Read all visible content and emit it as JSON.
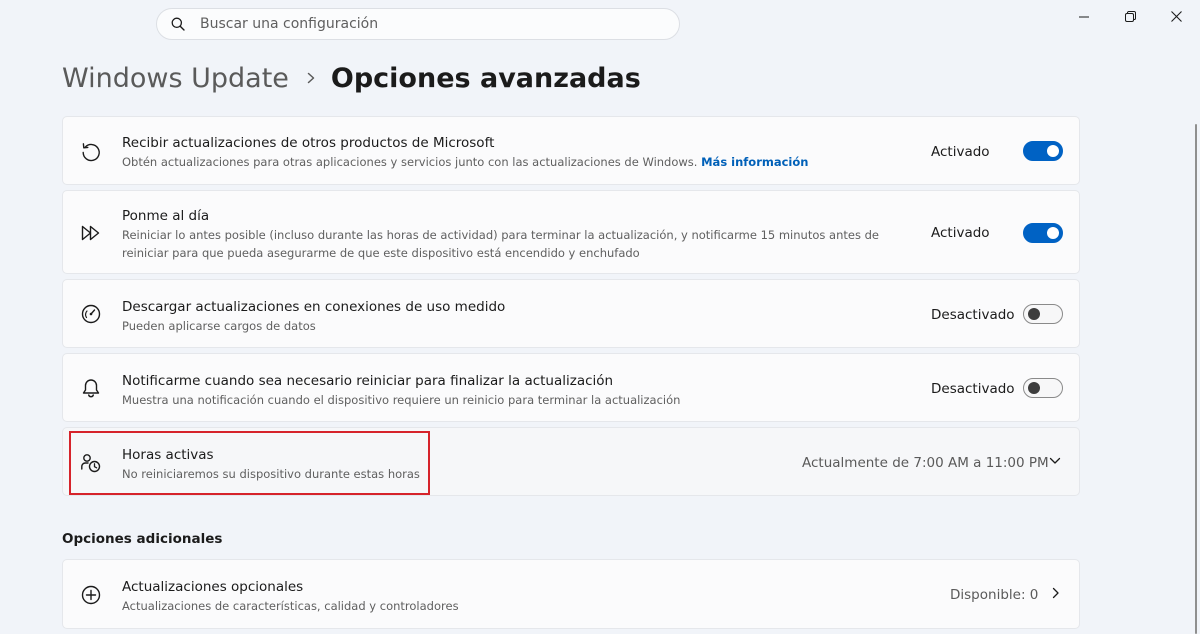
{
  "search": {
    "placeholder": "Buscar una configuración"
  },
  "window_controls": {
    "minimize": "minimize-icon",
    "restore": "restore-icon",
    "close": "close-icon"
  },
  "breadcrumb": {
    "parent": "Windows Update",
    "current": "Opciones avanzadas"
  },
  "settings": [
    {
      "title": "Recibir actualizaciones de otros productos de Microsoft",
      "description": "Obtén actualizaciones para otras aplicaciones y servicios junto con las actualizaciones de Windows.",
      "link": "Más información",
      "state": "Activado",
      "toggle_on": true,
      "icon": "refresh-icon"
    },
    {
      "title": "Ponme al día",
      "description": "Reiniciar lo antes posible (incluso durante las horas de actividad) para terminar la actualización, y notificarme 15 minutos antes de reiniciar para que pueda asegurarme de que este dispositivo está encendido y enchufado",
      "state": "Activado",
      "toggle_on": true,
      "icon": "fast-forward-icon"
    },
    {
      "title": "Descargar actualizaciones en conexiones de uso medido",
      "description": "Pueden aplicarse cargos de datos",
      "state": "Desactivado",
      "toggle_on": false,
      "icon": "gauge-icon"
    },
    {
      "title": "Notificarme cuando sea necesario reiniciar para finalizar la actualización",
      "description": "Muestra una notificación cuando el dispositivo requiere un reinicio para terminar la actualización",
      "state": "Desactivado",
      "toggle_on": false,
      "icon": "bell-icon"
    },
    {
      "title": "Horas activas",
      "description": "No reiniciaremos su dispositivo durante estas horas",
      "value": "Actualmente de 7:00 AM a 11:00 PM",
      "icon": "clock-person-icon"
    }
  ],
  "additional": {
    "heading": "Opciones adicionales",
    "items": [
      {
        "title": "Actualizaciones opcionales",
        "description": "Actualizaciones de características, calidad y controladores",
        "value": "Disponible: 0",
        "icon": "add-circle-icon"
      }
    ]
  },
  "colors": {
    "accent": "#0062c4",
    "link": "#0060b8",
    "highlight": "#d6232b",
    "background": "#f1f4f9"
  }
}
